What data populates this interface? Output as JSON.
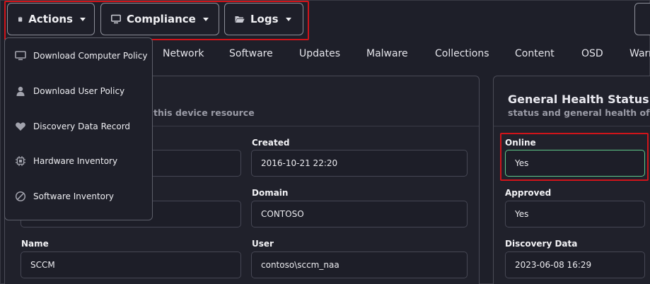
{
  "toolbar": {
    "actions_label": "Actions",
    "compliance_label": "Compliance",
    "logs_label": "Logs"
  },
  "actions_menu": [
    {
      "label": "Download Computer Policy",
      "icon": "monitor-icon"
    },
    {
      "label": "Download User Policy",
      "icon": "user-icon"
    },
    {
      "label": "Discovery Data Record",
      "icon": "heart-icon"
    },
    {
      "label": "Hardware Inventory",
      "icon": "chip-icon"
    },
    {
      "label": "Software Inventory",
      "icon": "disc-icon"
    }
  ],
  "tabs": [
    "Network",
    "Software",
    "Updates",
    "Malware",
    "Collections",
    "Content",
    "OSD",
    "Warn"
  ],
  "device_card": {
    "subtitle": "this device resource",
    "fields": {
      "created": {
        "label": "Created",
        "value": "2016-10-21 22:20"
      },
      "domain": {
        "label": "Domain",
        "value": "CONTOSO"
      },
      "name": {
        "label": "Name",
        "value": "SCCM"
      },
      "user": {
        "label": "User",
        "value": "contoso\\sccm_naa"
      }
    }
  },
  "health_card": {
    "title": "General Health Status",
    "subtitle": "status and general health of th",
    "fields": {
      "online": {
        "label": "Online",
        "value": "Yes"
      },
      "approved": {
        "label": "Approved",
        "value": "Yes"
      },
      "discovery": {
        "label": "Discovery Data",
        "value": "2023-06-08 16:29"
      }
    }
  },
  "colors": {
    "background": "#1e1f29",
    "highlight": "#d0141a",
    "online_border": "#5fc98a"
  }
}
